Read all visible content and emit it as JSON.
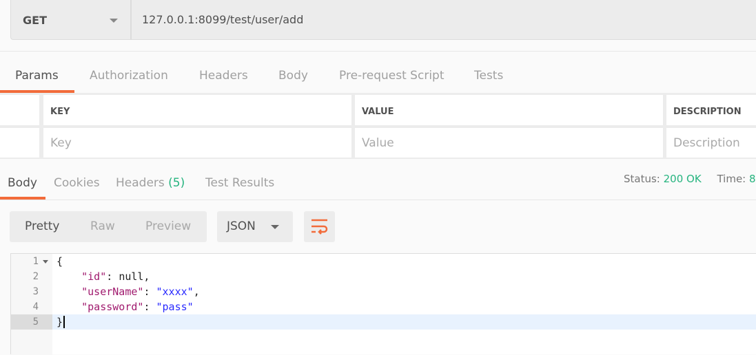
{
  "request": {
    "method": "GET",
    "url": "127.0.0.1:8099/test/user/add"
  },
  "request_tabs": [
    {
      "label": "Params",
      "active": true
    },
    {
      "label": "Authorization"
    },
    {
      "label": "Headers"
    },
    {
      "label": "Body"
    },
    {
      "label": "Pre-request Script"
    },
    {
      "label": "Tests"
    }
  ],
  "params_table": {
    "headers": [
      "KEY",
      "VALUE",
      "DESCRIPTION"
    ],
    "placeholders": [
      "Key",
      "Value",
      "Description"
    ]
  },
  "response_tabs": [
    {
      "label": "Body",
      "active": true
    },
    {
      "label": "Cookies"
    },
    {
      "label": "Headers",
      "count": "(5)"
    },
    {
      "label": "Test Results"
    }
  ],
  "status": {
    "status_label": "Status:",
    "status_value": "200 OK",
    "time_label": "Time:",
    "time_value": "8"
  },
  "view": {
    "modes": [
      "Pretty",
      "Raw",
      "Preview"
    ],
    "format": "JSON",
    "wrap_icon": "wrap-lines-icon"
  },
  "colors": {
    "accent": "#f26b3a",
    "success": "#26b47f",
    "key": "#a01a6e",
    "string": "#2a2aff"
  },
  "code": {
    "lines": [
      "1",
      "2",
      "3",
      "4",
      "5"
    ],
    "l1": "{",
    "indent": "    ",
    "id_key": "\"id\"",
    "id_val": "null,",
    "user_key": "\"userName\"",
    "user_val": "\"xxxx\"",
    "pass_key": "\"password\"",
    "pass_val": "\"pass\"",
    "colon": ": ",
    "comma": ",",
    "l5": "}"
  }
}
